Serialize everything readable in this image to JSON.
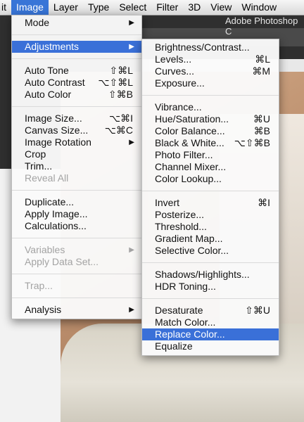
{
  "menubar": {
    "items": [
      "Image",
      "Layer",
      "Type",
      "Select",
      "Filter",
      "3D",
      "View",
      "Window"
    ],
    "first_partial": "it",
    "window_title": "Adobe Photoshop C"
  },
  "image_menu": {
    "mode": "Mode",
    "adjustments": "Adjustments",
    "auto_tone": {
      "label": "Auto Tone",
      "shortcut": "⇧⌘L"
    },
    "auto_contrast": {
      "label": "Auto Contrast",
      "shortcut": "⌥⇧⌘L"
    },
    "auto_color": {
      "label": "Auto Color",
      "shortcut": "⇧⌘B"
    },
    "image_size": {
      "label": "Image Size...",
      "shortcut": "⌥⌘I"
    },
    "canvas_size": {
      "label": "Canvas Size...",
      "shortcut": "⌥⌘C"
    },
    "image_rotation": "Image Rotation",
    "crop": "Crop",
    "trim": "Trim...",
    "reveal_all": "Reveal All",
    "duplicate": "Duplicate...",
    "apply_image": "Apply Image...",
    "calculations": "Calculations...",
    "variables": "Variables",
    "apply_data_set": "Apply Data Set...",
    "trap": "Trap...",
    "analysis": "Analysis"
  },
  "adjust_menu": {
    "brightness": "Brightness/Contrast...",
    "levels": {
      "label": "Levels...",
      "shortcut": "⌘L"
    },
    "curves": {
      "label": "Curves...",
      "shortcut": "⌘M"
    },
    "exposure": "Exposure...",
    "vibrance": "Vibrance...",
    "hue_sat": {
      "label": "Hue/Saturation...",
      "shortcut": "⌘U"
    },
    "color_balance": {
      "label": "Color Balance...",
      "shortcut": "⌘B"
    },
    "black_white": {
      "label": "Black & White...",
      "shortcut": "⌥⇧⌘B"
    },
    "photo_filter": "Photo Filter...",
    "channel_mixer": "Channel Mixer...",
    "color_lookup": "Color Lookup...",
    "invert": {
      "label": "Invert",
      "shortcut": "⌘I"
    },
    "posterize": "Posterize...",
    "threshold": "Threshold...",
    "gradient_map": "Gradient Map...",
    "selective_color": "Selective Color...",
    "shadows_highlights": "Shadows/Highlights...",
    "hdr_toning": "HDR Toning...",
    "desaturate": {
      "label": "Desaturate",
      "shortcut": "⇧⌘U"
    },
    "match_color": "Match Color...",
    "replace_color": "Replace Color...",
    "equalize": "Equalize"
  }
}
